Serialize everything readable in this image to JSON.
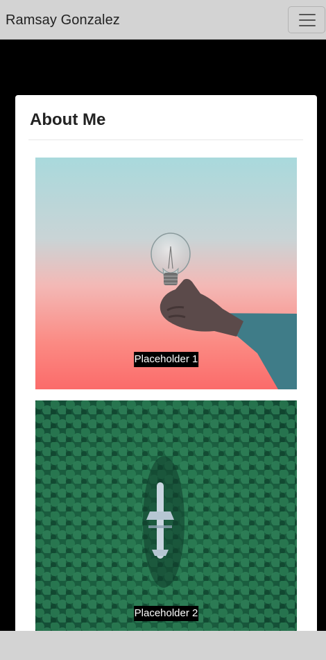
{
  "navbar": {
    "brand": "Ramsay Gonzalez",
    "toggler_icon": "hamburger-menu-icon"
  },
  "about": {
    "title": "About Me",
    "carousel": [
      {
        "caption": "Placeholder 1",
        "image": "lightbulb-in-hand-photo"
      },
      {
        "caption": "Placeholder 2",
        "image": "airplane-in-forest-photo"
      }
    ]
  },
  "colors": {
    "navbar_bg": "#d3d3d3",
    "page_bg": "#000000",
    "card_bg": "#ffffff"
  }
}
